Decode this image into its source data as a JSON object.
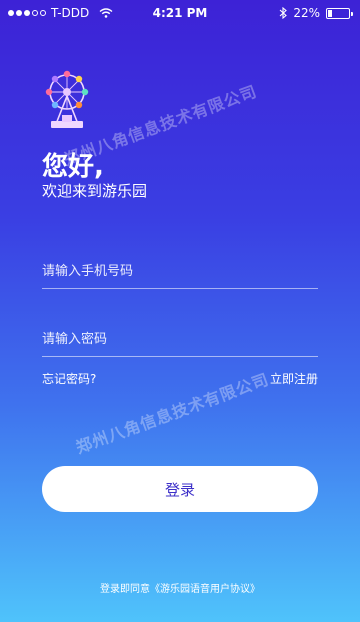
{
  "status_bar": {
    "carrier": "T-DDD",
    "time": "4:21 PM",
    "battery_level": "22%",
    "battery_fraction": 0.22,
    "signal_icon": "signal-dots-icon",
    "wifi_icon": "wifi-icon",
    "bluetooth_icon": "bluetooth-icon"
  },
  "logo": {
    "icon": "ferris-wheel-logo-icon"
  },
  "watermark": {
    "text": "郑州八角信息技术有限公司"
  },
  "greeting": {
    "title": "您好,",
    "subtitle": "欢迎来到游乐园"
  },
  "form": {
    "phone_placeholder": "请输入手机号码",
    "password_placeholder": "请输入密码",
    "forgot_password": "忘记密码?",
    "register": "立即注册",
    "login_button": "登录"
  },
  "agreement": {
    "text": "登录即同意《游乐园语音用户协议》"
  },
  "colors": {
    "gradient_top": "#3d22d6",
    "gradient_bottom": "#4fc3fb",
    "button_bg": "#ffffff",
    "button_text": "#3d30c9"
  }
}
